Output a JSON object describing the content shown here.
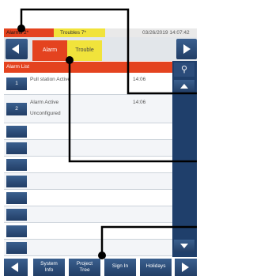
{
  "status_bar": {
    "alarms": "Alarms 2*",
    "troubles": "Troubles 7*",
    "datetime": "03/26/2019 14:07:42"
  },
  "nav": {
    "alarm_tab": "Alarm",
    "trouble_tab": "Trouble"
  },
  "list": {
    "header": "Alarm List",
    "rows": [
      {
        "number": "1",
        "text": "Pull station  Active",
        "time": "14:06"
      },
      {
        "number": "2",
        "text": "Alarm  Active",
        "text2": "Unconfigured",
        "time": "14:06"
      }
    ]
  },
  "side_panel": {
    "pin_icon": "location-pin-icon"
  },
  "bottom_bar": {
    "system_info_line1": "System",
    "system_info_line2": "Info",
    "project_tree_line1": "Project",
    "project_tree_line2": "Tree",
    "sign_in": "Sign In",
    "holidays": "Holidays"
  },
  "colors": {
    "alarm": "#e4431f",
    "trouble": "#f1e33b",
    "button_blue": "#223e66",
    "annotation": "#000000"
  }
}
